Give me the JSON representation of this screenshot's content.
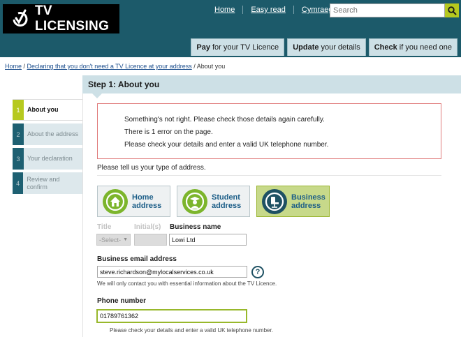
{
  "header": {
    "logo_text": "TV LICENSING",
    "links": [
      "Home",
      "Easy read",
      "Cymraeg"
    ],
    "search_placeholder": "Search",
    "tabs": [
      {
        "bold": "Pay",
        "rest": "for your TV Licence"
      },
      {
        "bold": "Update",
        "rest": "your details"
      },
      {
        "bold": "Check",
        "rest": "if you need one"
      }
    ]
  },
  "breadcrumb": {
    "home": "Home",
    "sep1": " / ",
    "declaring": "Declaring that you don't need a TV Licence at your address",
    "sep2": " / ",
    "current": "About you"
  },
  "steps": [
    {
      "num": "1",
      "label": "About you"
    },
    {
      "num": "2",
      "label": "About the address"
    },
    {
      "num": "3",
      "label": "Your declaration"
    },
    {
      "num": "4",
      "label": "Review and confirm"
    }
  ],
  "panel": {
    "title": "Step 1: About you",
    "error_lines": [
      "Something's not right. Please check those details again carefully.",
      "There is 1 error on the page.",
      "Please check your details and enter a valid UK telephone number."
    ],
    "address_question": "Please tell us your type of address.",
    "address_types": [
      {
        "line1": "Home",
        "line2": "address",
        "icon": "house-icon"
      },
      {
        "line1": "Student",
        "line2": "address",
        "icon": "student-icon"
      },
      {
        "line1": "Business",
        "line2": "address",
        "icon": "office-chair-icon"
      }
    ],
    "title_label": "Title",
    "title_select": "-Select-",
    "initials_label": "Initial(s)",
    "business_name_label": "Business name",
    "business_name_value": "Lowi Ltd",
    "email_label": "Business email address",
    "email_value": "steve.richardson@mylocalservices.co.uk",
    "email_help": "?",
    "email_note": "We will only contact you with essential information about the TV Licence.",
    "phone_label": "Phone number",
    "phone_value": "01789761362",
    "phone_error": "Please check your details and enter a valid UK telephone number."
  },
  "colors": {
    "header_bg": "#1c5a6a",
    "accent_green": "#b6c91f",
    "error_border": "#e07b7b"
  }
}
